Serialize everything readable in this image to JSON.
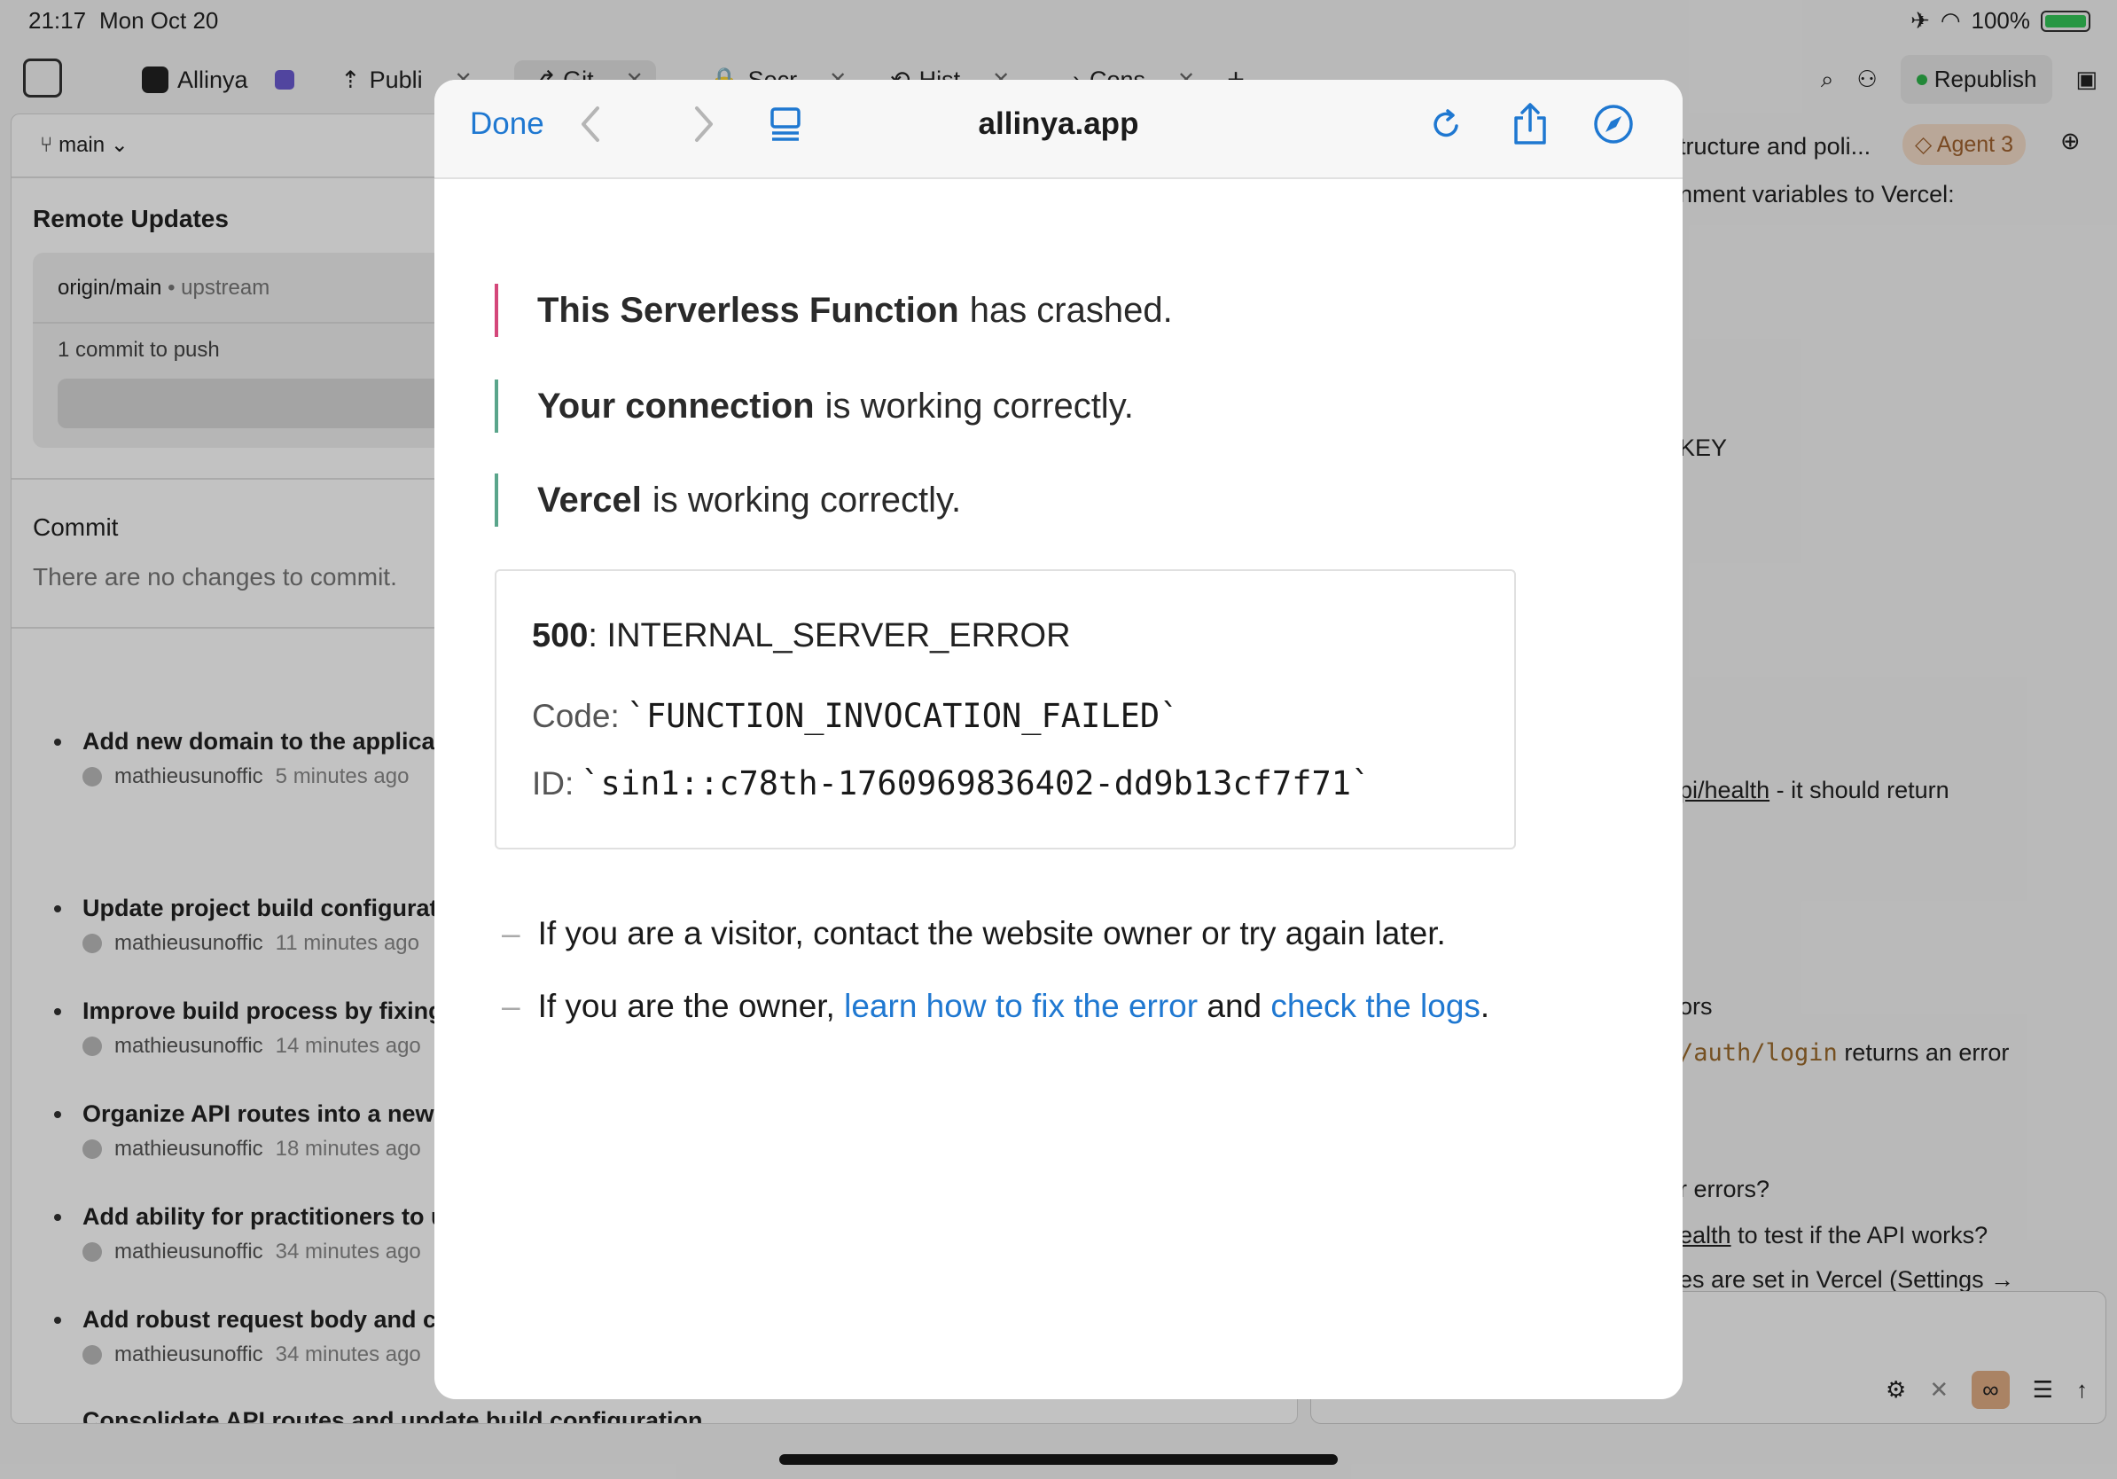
{
  "status_bar": {
    "time": "21:17",
    "date": "Mon Oct 20",
    "battery": "100%"
  },
  "tabs": [
    {
      "label": "Allinya"
    },
    {
      "label": "Publi"
    },
    {
      "label": "Git"
    },
    {
      "label": "Secr"
    },
    {
      "label": "Hist"
    },
    {
      "label": "Cons"
    }
  ],
  "toolbar": {
    "republish_label": "Republish"
  },
  "git": {
    "branch": "main",
    "remote_title": "Remote Updates",
    "upstream_branch": "origin/main",
    "upstream_label": "upstream",
    "commits_to_push": "1 commit to push",
    "commit_title": "Commit",
    "no_changes": "There are no changes to commit.",
    "history": [
      {
        "title": "Add new domain to the applica",
        "author": "mathieusunoffic",
        "ago": "5 minutes ago"
      },
      {
        "title": "Update project build configurat",
        "author": "mathieusunoffic",
        "ago": "11 minutes ago"
      },
      {
        "title": "Improve build process by fixing",
        "author": "mathieusunoffic",
        "ago": "14 minutes ago"
      },
      {
        "title": "Organize API routes into a new",
        "author": "mathieusunoffic",
        "ago": "18 minutes ago"
      },
      {
        "title": "Add ability for practitioners to u",
        "author": "mathieusunoffic",
        "ago": "34 minutes ago"
      },
      {
        "title": "Add robust request body and co",
        "author": "mathieusunoffic",
        "ago": "34 minutes ago"
      },
      {
        "title": "Consolidate API routes and update build configuration",
        "author": "",
        "ago": ""
      }
    ]
  },
  "agent_panel": {
    "header_text": "tructure and poli...",
    "agent_badge": "Agent 3",
    "lines": [
      "nment variables to Vercel:",
      "KEY",
      "pi/health",
      " - it should return",
      "ors",
      "/auth/login",
      " returns an error",
      "r errors?",
      "ealth",
      " to test if the API works?",
      "es are set in Vercel (Settings →"
    ]
  },
  "browser": {
    "done_label": "Done",
    "url": "allinya.app",
    "status_lines": [
      {
        "bold": "This Serverless Function",
        "rest": "has crashed.",
        "color": "#d4477a"
      },
      {
        "bold": "Your connection",
        "rest": "is working correctly.",
        "color": "#5aa58b"
      },
      {
        "bold": "Vercel",
        "rest": "is working correctly.",
        "color": "#5aa58b"
      }
    ],
    "error": {
      "code_number": "500",
      "code_text": ": INTERNAL_SERVER_ERROR",
      "code_label": "Code:",
      "code_value": "`FUNCTION_INVOCATION_FAILED`",
      "id_label": "ID:",
      "id_value": "`sin1::c78th-1760969836402-dd9b13cf7f71`"
    },
    "help": {
      "visitor": "If you are a visitor, contact the website owner or try again later.",
      "owner_prefix": "If you are the owner, ",
      "link_fix": "learn how to fix the error",
      "and": " and ",
      "link_logs": "check the logs",
      "period": "."
    }
  },
  "colors": {
    "accent": "#1f78d1",
    "crash": "#d4477a",
    "ok": "#5aa58b"
  }
}
